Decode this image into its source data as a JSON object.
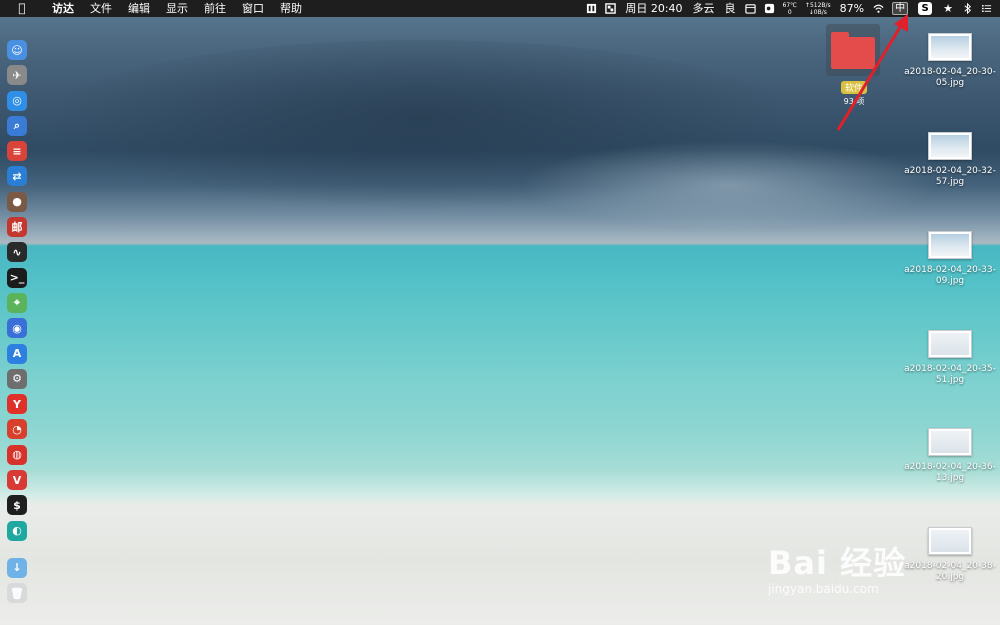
{
  "menubar": {
    "app_name": "访达",
    "menus": [
      "文件",
      "编辑",
      "显示",
      "前往",
      "窗口",
      "帮助"
    ],
    "datetime": "周日 20:40",
    "weather": "多云",
    "air_quality": "良",
    "temperature": "67℃",
    "temperature_sub": "0",
    "net_up": "↑512B/s",
    "net_down": "↓0B/s",
    "battery": "87%",
    "input_method": "中",
    "icons": [
      "apple-icon",
      "tray-app-icon",
      "tray-app-icon-2",
      "calendar-icon",
      "wechat-icon",
      "display-icon",
      "wifi-icon",
      "s-app-icon",
      "star-icon",
      "bluetooth-icon",
      "list-icon"
    ]
  },
  "dock": {
    "items": [
      {
        "name": "finder",
        "color": "#4a90e2",
        "glyph": "☺"
      },
      {
        "name": "launchpad",
        "color": "#8a8a8a",
        "glyph": "✈"
      },
      {
        "name": "safari",
        "color": "#2f8ee5",
        "glyph": "◎"
      },
      {
        "name": "preview",
        "color": "#3a7bd5",
        "glyph": "⌕"
      },
      {
        "name": "app-red",
        "color": "#d9443a",
        "glyph": "≡"
      },
      {
        "name": "teamviewer",
        "color": "#2a7fd4",
        "glyph": "⇄"
      },
      {
        "name": "app-brown",
        "color": "#7a5a45",
        "glyph": "●"
      },
      {
        "name": "app-mail-red",
        "color": "#c4372e",
        "glyph": "邮"
      },
      {
        "name": "activity-monitor",
        "color": "#2a2a2a",
        "glyph": "∿"
      },
      {
        "name": "terminal",
        "color": "#1c1c1c",
        "glyph": ">_"
      },
      {
        "name": "maps",
        "color": "#5bb45a",
        "glyph": "⌖"
      },
      {
        "name": "siri",
        "color": "#3a6fd8",
        "glyph": "◉"
      },
      {
        "name": "app-store",
        "color": "#2d7fe0",
        "glyph": "A"
      },
      {
        "name": "system-preferences",
        "color": "#6e6e6e",
        "glyph": "⚙"
      },
      {
        "name": "yandex",
        "color": "#e0302a",
        "glyph": "Y"
      },
      {
        "name": "chrome",
        "color": "#d8402e",
        "glyph": "◔"
      },
      {
        "name": "netease-music",
        "color": "#d8302a",
        "glyph": "◍"
      },
      {
        "name": "vivaldi",
        "color": "#d83a36",
        "glyph": "V"
      },
      {
        "name": "console",
        "color": "#1e1e1e",
        "glyph": "$"
      },
      {
        "name": "app-teal",
        "color": "#1fa8a0",
        "glyph": "◐"
      }
    ],
    "folder": {
      "name": "downloads",
      "color": "#6fb3e6",
      "glyph": "↓"
    },
    "trash": {
      "name": "trash",
      "color": "#d7d9db",
      "glyph": "🗑"
    }
  },
  "desktop": {
    "folder": {
      "label": "软件",
      "sub": "93 项"
    },
    "files": [
      {
        "name": "a2018-02-04_20-30-05.jpg"
      },
      {
        "name": "a2018-02-04_20-32-57.jpg"
      },
      {
        "name": "a2018-02-04_20-33-09.jpg"
      },
      {
        "name": "a2018-02-04_20-35-51.jpg"
      },
      {
        "name": "a2018-02-04_20-36-13.jpg"
      },
      {
        "name": "a2018-02-04_20-38-20.jpg"
      }
    ]
  },
  "watermark": {
    "main": "Bai 经验",
    "sub": "jingyan.baidu.com"
  },
  "annotation": {
    "color": "#e0202a"
  }
}
